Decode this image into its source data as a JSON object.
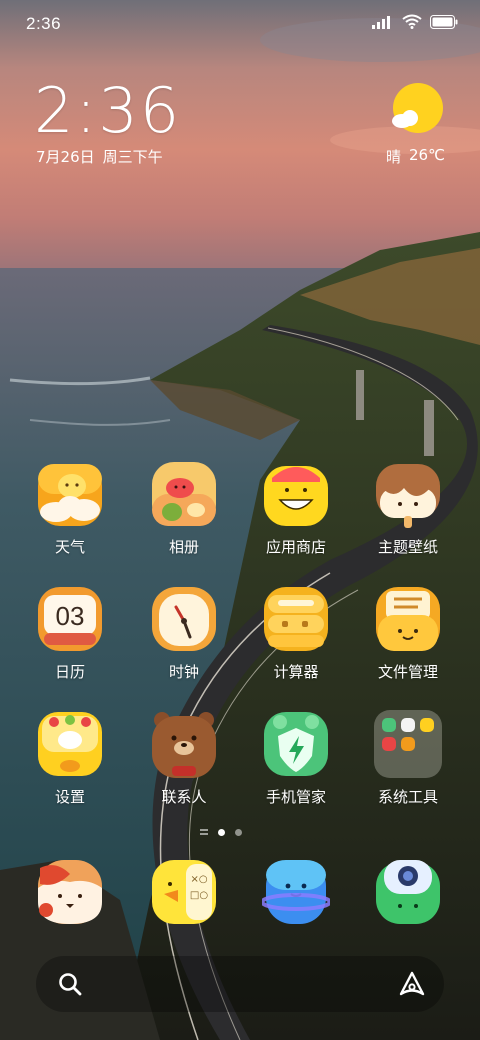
{
  "status_bar": {
    "time": "2:36"
  },
  "clock_widget": {
    "time": "2:36",
    "date": "7月26日",
    "weekday": "周三下午"
  },
  "weather_widget": {
    "condition": "晴",
    "temperature": "26℃"
  },
  "apps": [
    {
      "label": "天气",
      "icon": "weather-app-icon"
    },
    {
      "label": "相册",
      "icon": "gallery-app-icon"
    },
    {
      "label": "应用商店",
      "icon": "app-store-icon"
    },
    {
      "label": "主题壁纸",
      "icon": "themes-icon"
    },
    {
      "label": "日历",
      "icon": "calendar-app-icon",
      "badge": "03"
    },
    {
      "label": "时钟",
      "icon": "clock-app-icon"
    },
    {
      "label": "计算器",
      "icon": "calculator-app-icon"
    },
    {
      "label": "文件管理",
      "icon": "file-manager-icon"
    },
    {
      "label": "设置",
      "icon": "settings-app-icon"
    },
    {
      "label": "联系人",
      "icon": "contacts-app-icon"
    },
    {
      "label": "手机管家",
      "icon": "security-app-icon"
    },
    {
      "label": "系统工具",
      "icon": "system-tools-folder-icon"
    }
  ],
  "dock": [
    {
      "icon": "phone-app-icon"
    },
    {
      "icon": "messages-app-icon"
    },
    {
      "icon": "browser-app-icon"
    },
    {
      "icon": "camera-app-icon"
    }
  ],
  "page_indicator": {
    "pages": 2,
    "current": 1
  },
  "bottom_bar": {
    "left": "search-icon",
    "right": "assistant-icon"
  }
}
